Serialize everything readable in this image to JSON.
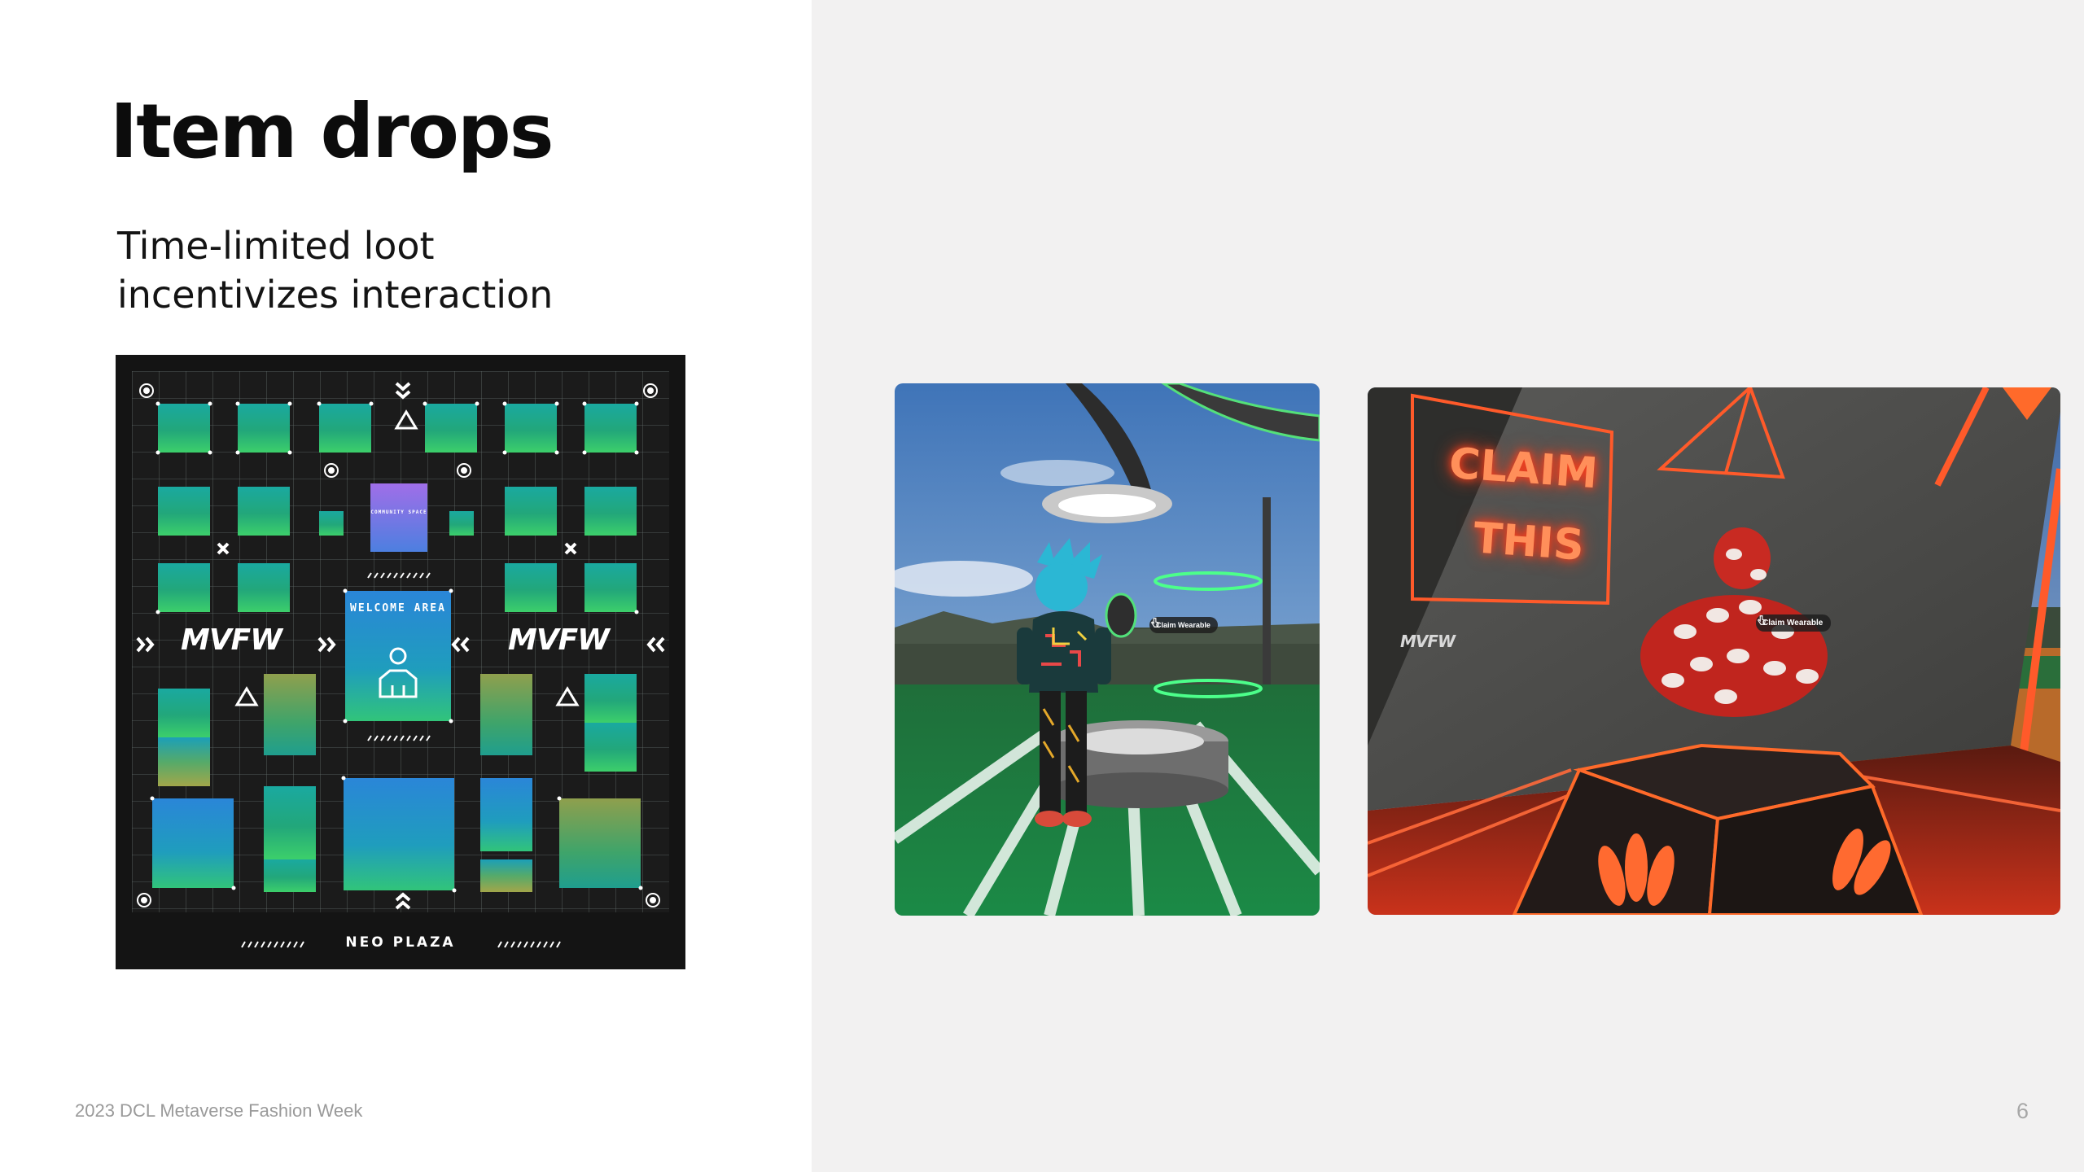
{
  "slide": {
    "title": "Item drops",
    "subtitle_lines": [
      "Time-limited loot",
      "incentivizes interaction"
    ],
    "footer": "2023 DCL Metaverse Fashion Week",
    "page_number": "6"
  },
  "map": {
    "logo_left": "MVFW",
    "logo_right": "MVFW",
    "welcome": "WELCOME AREA",
    "community": "COMMUNITY SPACE",
    "plaza": "NEO PLAZA",
    "colors": {
      "green_tile": "#1fa582",
      "blue_tile": "#2f8fd4",
      "purple_tile": "#8f6ee0",
      "olive_tile": "#9ea84a",
      "grid": "#cfd8d6"
    }
  },
  "screenshot_left": {
    "tooltip": "Claim Wearable"
  },
  "screenshot_right": {
    "tooltip": "Claim Wearable",
    "neon_sign": [
      "CLAIM",
      "THIS"
    ],
    "sign_logo": "MVFW",
    "neon_color": "#ff4a1c"
  }
}
